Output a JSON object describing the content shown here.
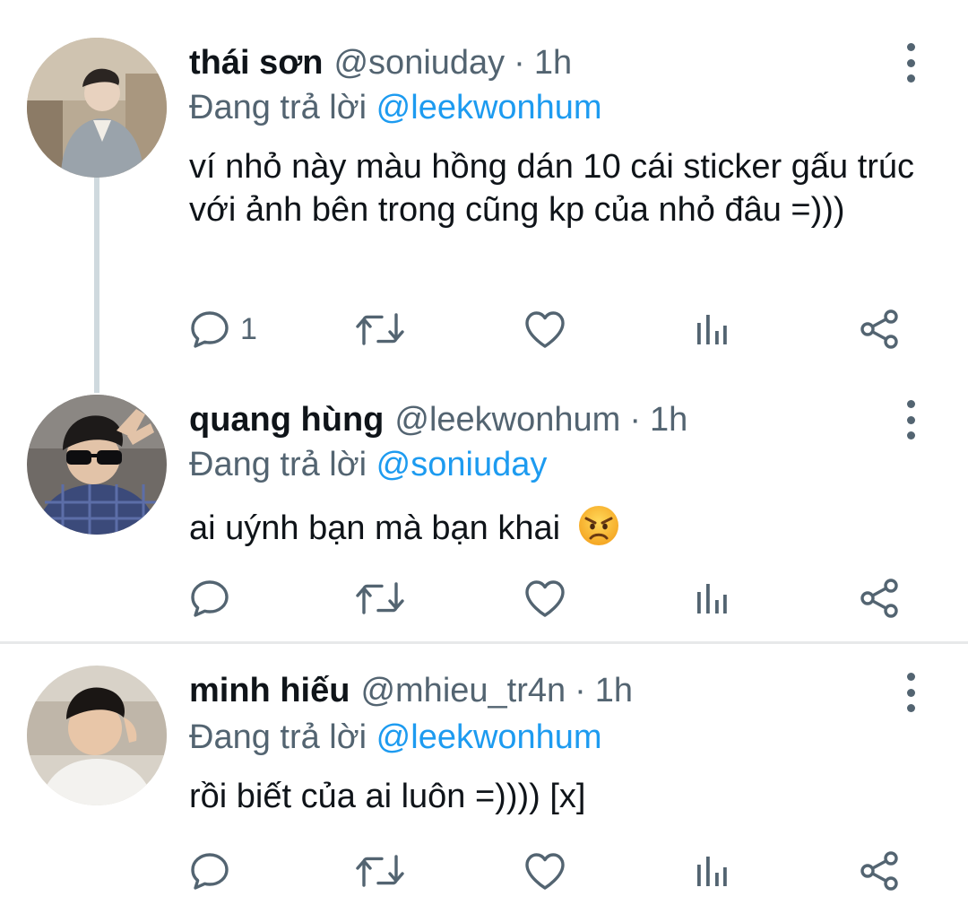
{
  "tweets": [
    {
      "name": "thái sơn",
      "handle": "@soniuday",
      "dot": "·",
      "time": "1h",
      "reply_prefix": "Đang trả lời",
      "reply_to": "@leekwonhum",
      "text": "ví nhỏ này màu hồng dán 10 cái sticker gấu trúc với ảnh bên trong cũng kp của nhỏ đâu =)))",
      "reply_count": "1",
      "avatar_icon": "avatar-photo"
    },
    {
      "name": "quang hùng",
      "handle": "@leekwonhum",
      "dot": "·",
      "time": "1h",
      "reply_prefix": "Đang trả lời",
      "reply_to": "@soniuday",
      "text": "ai uýnh bạn mà bạn khai",
      "emoji": "angry-face-icon",
      "reply_count": "",
      "avatar_icon": "avatar-photo"
    },
    {
      "name": "minh hiếu",
      "handle": "@mhieu_tr4n",
      "dot": "·",
      "time": "1h",
      "reply_prefix": "Đang trả lời",
      "reply_to": "@leekwonhum",
      "text": "rồi biết của ai luôn =)))) [x]",
      "reply_count": "",
      "avatar_icon": "avatar-photo"
    }
  ],
  "colors": {
    "text": "#0f1419",
    "secondary": "#536471",
    "accent": "#1d9bf0",
    "divider": "#e7e9ea"
  },
  "action_icons": [
    "reply-icon",
    "retweet-icon",
    "like-icon",
    "analytics-icon",
    "share-icon"
  ]
}
